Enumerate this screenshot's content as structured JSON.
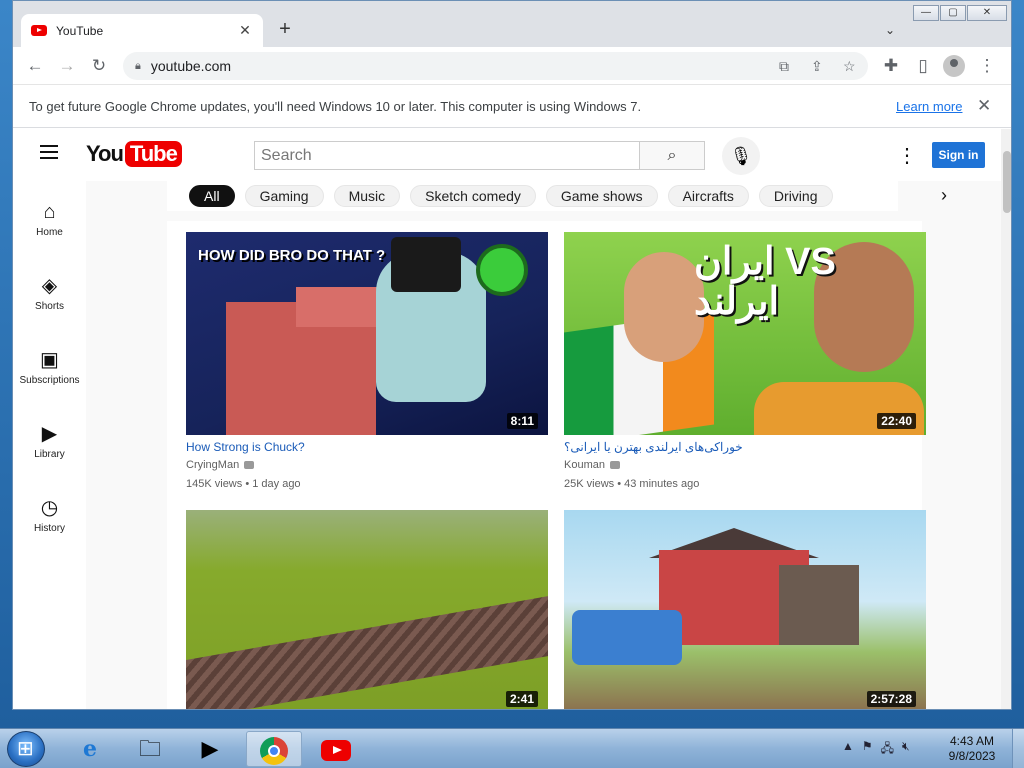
{
  "browser": {
    "tab_title": "YouTube",
    "tab_close": "✕",
    "new_tab": "+",
    "tab_search": "⌄",
    "url": "youtube.com",
    "win_minimize": "—",
    "win_maximize": "▢",
    "win_close": "✕"
  },
  "infobar": {
    "message": "To get future Google Chrome updates, you'll need Windows 10 or later. This computer is using Windows 7.",
    "learn_more": "Learn more",
    "close": "✕"
  },
  "youtube": {
    "logo_you": "You",
    "logo_tube": "Tube",
    "search_placeholder": "Search",
    "sign_in": "Sign in",
    "sidebar": [
      {
        "label": "Home",
        "icon": "home-icon",
        "glyph": "⌂"
      },
      {
        "label": "Shorts",
        "icon": "shorts-icon",
        "glyph": "◈"
      },
      {
        "label": "Subscriptions",
        "icon": "subscriptions-icon",
        "glyph": "▣"
      },
      {
        "label": "Library",
        "icon": "library-icon",
        "glyph": "▶"
      },
      {
        "label": "History",
        "icon": "history-icon",
        "glyph": "◷"
      }
    ],
    "chips": [
      "All",
      "Gaming",
      "Music",
      "Sketch comedy",
      "Game shows",
      "Aircrafts",
      "Driving"
    ],
    "videos": [
      {
        "title": "How Strong is Chuck?",
        "channel": "CryingMan",
        "views": "145K views",
        "age": "1 day ago",
        "duration": "8:11",
        "overlay": "HOW DID BRO DO THAT ?"
      },
      {
        "title": "خوراکی‌های ایرلندی بهترن یا ایرانی؟",
        "channel": "Kouman",
        "views": "25K views",
        "age": "43 minutes ago",
        "duration": "22:40",
        "overlay": "ایران VS ایرلند"
      },
      {
        "duration": "2:41"
      },
      {
        "duration": "2:57:28"
      }
    ]
  },
  "taskbar": {
    "clock_time": "4:43 AM",
    "clock_date": "9/8/2023"
  },
  "colors": {
    "youtube_red": "#ff0000",
    "sign_in_blue": "#1f73d6",
    "link_blue": "#1a73e8"
  }
}
